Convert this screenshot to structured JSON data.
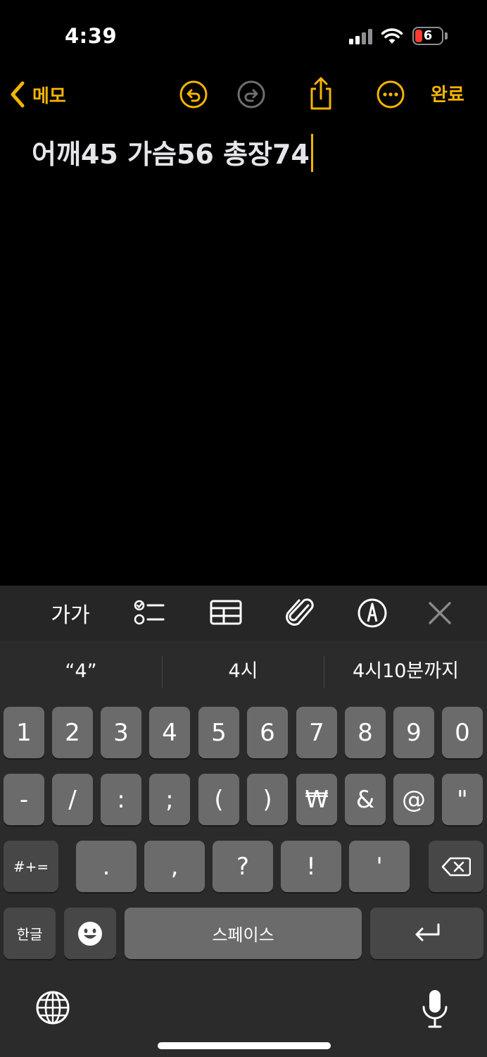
{
  "status_bar": {
    "time": "4:39",
    "battery": "6"
  },
  "nav": {
    "back_label": "메모",
    "done_label": "완료"
  },
  "note": {
    "text": "어깨45 가슴56 총장74"
  },
  "format_toolbar": {
    "text_format": "가가"
  },
  "suggestions": [
    "“4”",
    "4시",
    "4시10분까지"
  ],
  "keyboard": {
    "row1": [
      "1",
      "2",
      "3",
      "4",
      "5",
      "6",
      "7",
      "8",
      "9",
      "0"
    ],
    "row2": [
      "-",
      "/",
      ":",
      ";",
      "(",
      ")",
      "₩",
      "&",
      "@",
      "\""
    ],
    "row3": {
      "mode": "#+=",
      "keys": [
        ".",
        ",",
        "?",
        "!",
        "'"
      ]
    },
    "row4": {
      "lang": "한글",
      "space": "스페이스"
    }
  },
  "colors": {
    "accent": "#f4b400",
    "key": "#6b6b6b",
    "key_dark": "#474747",
    "keyboard_bg": "#2b2b2b",
    "toolbar_bg": "#262626"
  }
}
